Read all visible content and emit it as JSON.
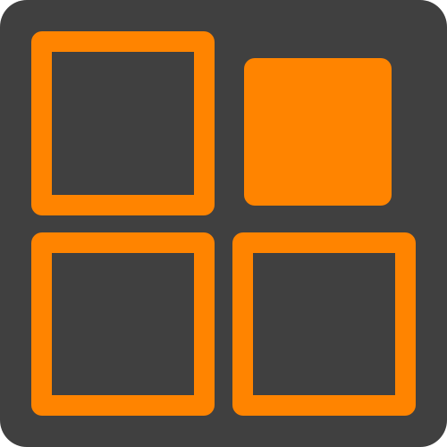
{
  "icon": {
    "name": "grid-layout-icon",
    "background_color": "#404040",
    "accent_color": "#ff8400",
    "tiles": [
      {
        "id": "tile-top-left",
        "name": "grid-tile-outline-icon",
        "style": "outline"
      },
      {
        "id": "tile-top-right",
        "name": "grid-tile-filled-icon",
        "style": "filled"
      },
      {
        "id": "tile-bottom-left",
        "name": "grid-tile-outline-icon",
        "style": "outline"
      },
      {
        "id": "tile-bottom-right",
        "name": "grid-tile-outline-icon",
        "style": "outline"
      }
    ]
  }
}
